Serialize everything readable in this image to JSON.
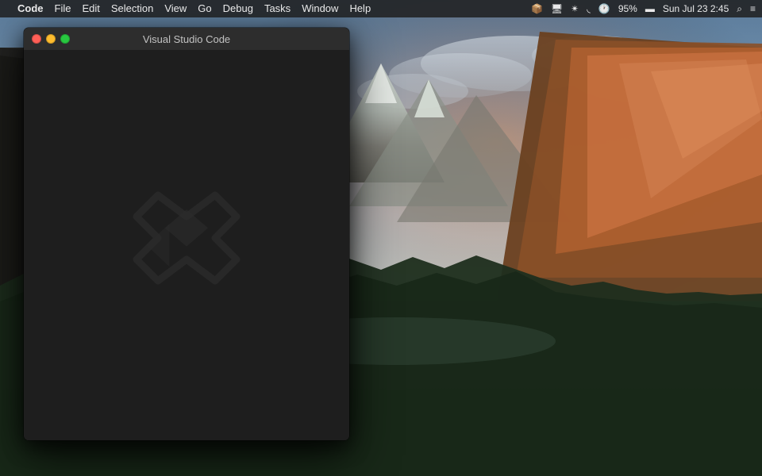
{
  "menubar": {
    "apple_symbol": "",
    "app_name": "Code",
    "items": [
      "File",
      "Edit",
      "Selection",
      "View",
      "Go",
      "Debug",
      "Tasks",
      "Window",
      "Help"
    ],
    "right_items": {
      "battery_icon": "🔋",
      "battery_pct": "95%",
      "datetime": "Sun Jul 23  2:45",
      "wifi_icon": "wifi",
      "search_icon": "search",
      "list_icon": "list"
    }
  },
  "window": {
    "title": "Visual Studio Code",
    "controls": {
      "close_label": "close",
      "minimize_label": "minimize",
      "maximize_label": "maximize"
    }
  }
}
